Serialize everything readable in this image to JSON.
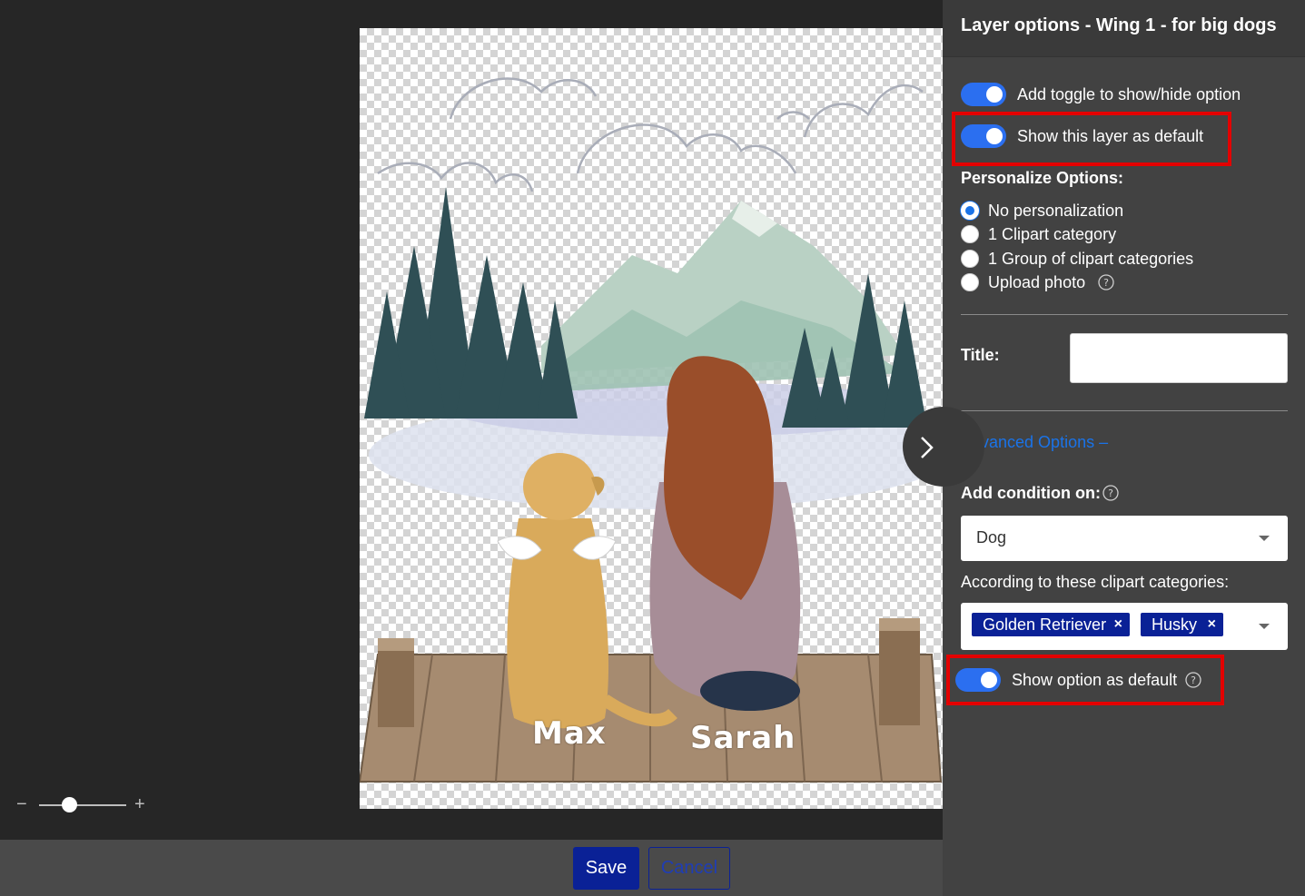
{
  "canvas": {
    "names": {
      "dog": "Max",
      "person": "Sarah"
    }
  },
  "zoom": {
    "minus": "−",
    "plus": "+",
    "level": 0.35
  },
  "footer": {
    "save_label": "Save",
    "cancel_label": "Cancel"
  },
  "panel": {
    "title": "Layer options - Wing 1 - for big dogs",
    "toggle_show_hide": {
      "label": "Add toggle to show/hide option",
      "on": true
    },
    "toggle_default_layer": {
      "label": "Show this layer as default",
      "on": true
    },
    "personalize": {
      "heading": "Personalize Options:",
      "options": [
        {
          "label": "No personalization",
          "checked": true
        },
        {
          "label": "1 Clipart category",
          "checked": false
        },
        {
          "label": "1 Group of clipart categories",
          "checked": false
        },
        {
          "label": "Upload photo",
          "checked": false
        }
      ]
    },
    "title_field": {
      "label": "Title:",
      "value": ""
    },
    "advanced": {
      "label": "Advanced Options",
      "suffix": "–"
    },
    "condition": {
      "label": "Add condition on:",
      "selected": "Dog",
      "categories_label": "According to these clipart categories:",
      "chips": [
        "Golden Retriever",
        "Husky"
      ],
      "chip_remove": "×"
    },
    "toggle_default_option": {
      "label": "Show option as default",
      "on": true
    }
  },
  "colors": {
    "accent": "#2b6ff0",
    "brand": "#0a2196",
    "highlight": "#e30000",
    "link": "#1a73e8"
  }
}
